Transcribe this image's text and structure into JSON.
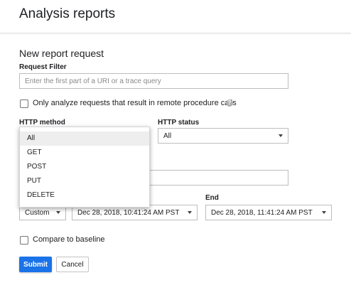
{
  "header": {
    "title": "Analysis reports"
  },
  "form": {
    "section_title": "New report request",
    "request_filter": {
      "label": "Request Filter",
      "placeholder": "Enter the first part of a URI or a trace query"
    },
    "rpc_checkbox": {
      "label": "Only analyze requests that result in remote procedure calls",
      "checked": false
    },
    "http_method": {
      "label": "HTTP method",
      "value": "All",
      "options": [
        "All",
        "GET",
        "POST",
        "PUT",
        "DELETE"
      ],
      "open": true
    },
    "http_status": {
      "label": "HTTP status",
      "value": "All"
    },
    "time_range": {
      "value": "Custom"
    },
    "start": {
      "value": "Dec 28, 2018, 10:41:24 AM PST"
    },
    "end": {
      "label": "End",
      "value": "Dec 28, 2018, 11:41:24 AM PST"
    },
    "baseline_checkbox": {
      "label": "Compare to baseline",
      "checked": false
    },
    "submit_label": "Submit",
    "cancel_label": "Cancel"
  }
}
